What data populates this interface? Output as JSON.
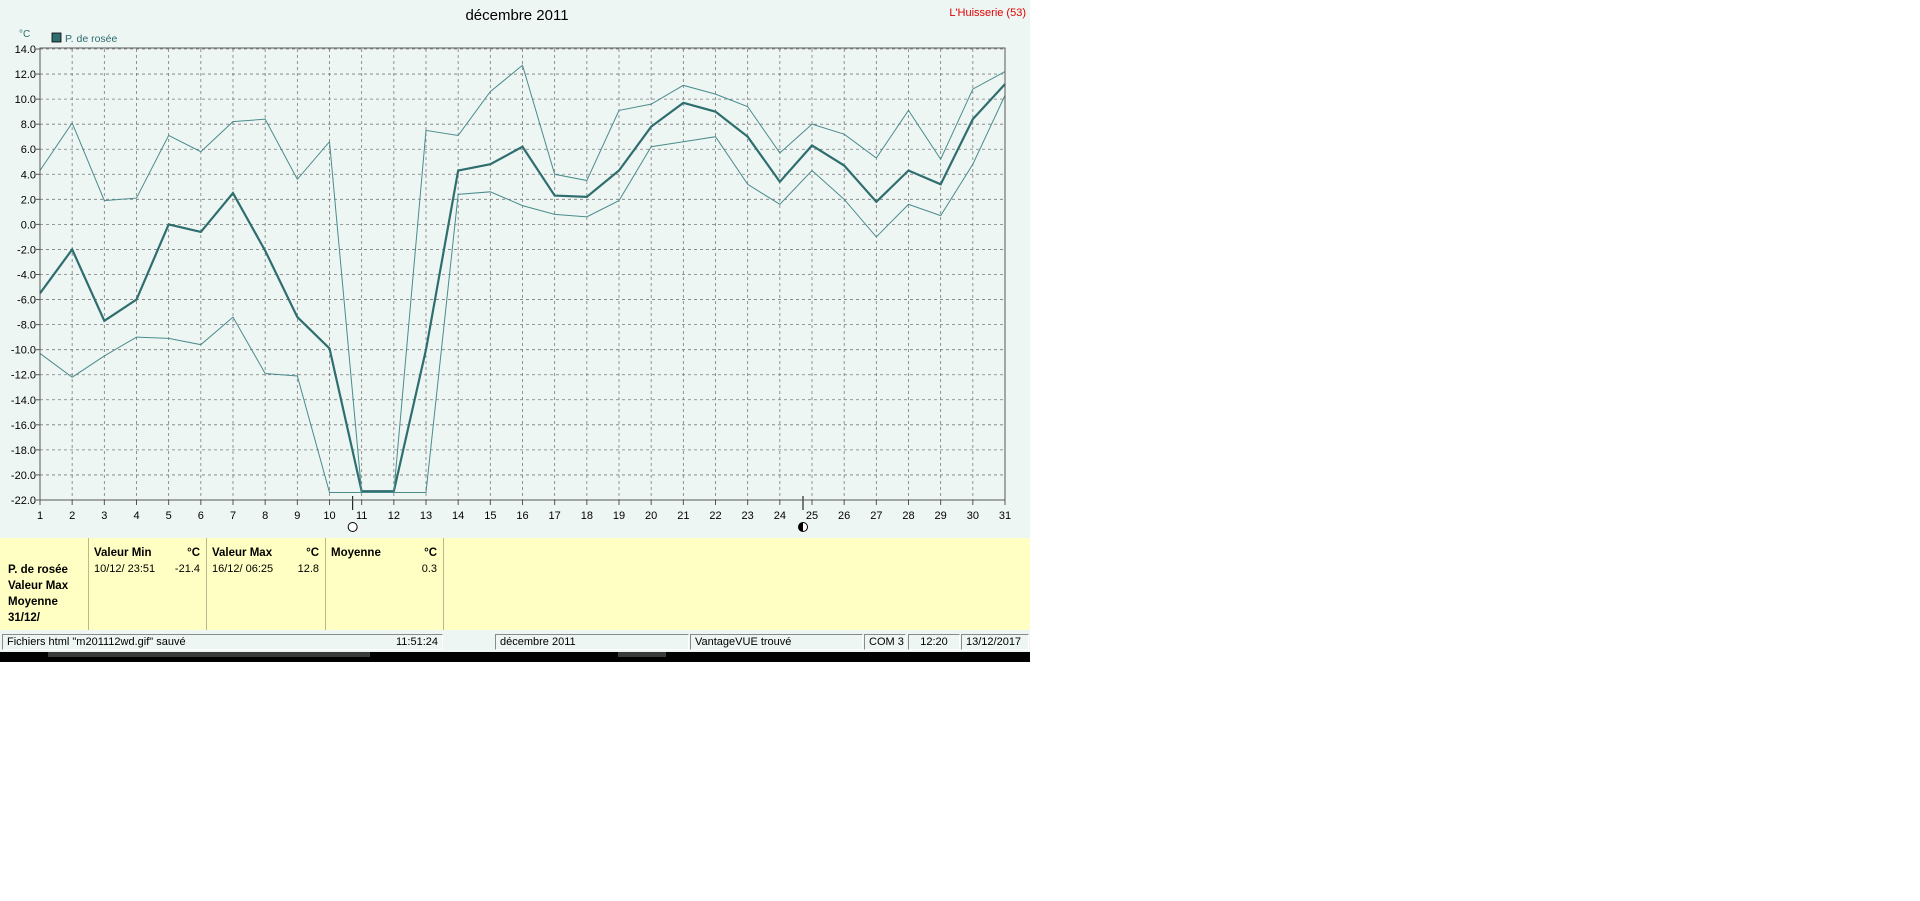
{
  "chart_data": {
    "type": "line",
    "title": "décembre 2011",
    "station": "L'Huisserie (53)",
    "ylabel": "°C",
    "legend": [
      "P. de rosée"
    ],
    "legend_position": "top-left",
    "grid": true,
    "ylim": [
      -22,
      14
    ],
    "y_ticks": [
      "14.0",
      "12.0",
      "10.0",
      "8.0",
      "6.0",
      "4.0",
      "2.0",
      "0.0",
      "-2.0",
      "-4.0",
      "-6.0",
      "-8.0",
      "-10.0",
      "-12.0",
      "-14.0",
      "-16.0",
      "-18.0",
      "-20.0",
      "-22.0"
    ],
    "x": [
      "1",
      "2",
      "3",
      "4",
      "5",
      "6",
      "7",
      "8",
      "9",
      "10",
      "11",
      "12",
      "13",
      "14",
      "15",
      "16",
      "17",
      "18",
      "19",
      "20",
      "21",
      "22",
      "23",
      "24",
      "25",
      "26",
      "27",
      "28",
      "29",
      "30",
      "31"
    ],
    "series": [
      {
        "name": "P. de rosée",
        "values": [
          -5.5,
          -2.0,
          -7.7,
          -6.0,
          0.0,
          -0.6,
          2.5,
          -2.1,
          -7.4,
          -9.9,
          -21.3,
          -21.3,
          -10.0,
          4.3,
          4.8,
          6.2,
          2.3,
          2.2,
          4.3,
          7.8,
          9.7,
          9.0,
          7.0,
          3.4,
          6.3,
          4.7,
          1.8,
          4.3,
          3.2,
          8.4,
          11.2
        ]
      },
      {
        "name": "",
        "values": [
          4.3,
          8.1,
          1.9,
          2.1,
          7.1,
          5.8,
          8.2,
          8.4,
          3.6,
          6.6,
          -21.4,
          -21.4,
          7.5,
          7.1,
          10.6,
          12.7,
          4.0,
          3.5,
          9.1,
          9.6,
          11.1,
          10.4,
          9.4,
          5.7,
          8.0,
          7.2,
          5.3,
          9.1,
          5.2,
          10.8,
          12.2
        ]
      },
      {
        "name": "",
        "values": [
          -10.3,
          -12.2,
          -10.5,
          -9.0,
          -9.1,
          -9.6,
          -7.4,
          -11.9,
          -12.1,
          -21.4,
          -21.4,
          -21.4,
          -21.4,
          2.4,
          2.6,
          1.5,
          0.8,
          0.6,
          1.9,
          6.2,
          6.6,
          7.0,
          3.2,
          1.6,
          4.3,
          2.0,
          -1.0,
          1.6,
          0.7,
          4.8,
          10.3
        ]
      }
    ],
    "moon_markers": [
      {
        "day": "11",
        "phase": "new"
      },
      {
        "day": "25",
        "phase": "first-quarter"
      }
    ]
  },
  "summary": {
    "names": [
      "P. de rosée",
      "Valeur Max",
      "Moyenne",
      "31/12/"
    ],
    "min": {
      "header": "Valeur Min",
      "unit": "°C",
      "date": "10/12/  23:51",
      "value": "-21.4"
    },
    "max": {
      "header": "Valeur Max",
      "unit": "°C",
      "date": "16/12/  06:25",
      "value": "12.8"
    },
    "avg": {
      "header": "Moyenne",
      "unit": "°C",
      "value": "0.3"
    }
  },
  "statusbar": {
    "message": "Fichiers html  \"m201112wd.gif\"  sauvé",
    "time": "11:51:24",
    "period": "décembre 2011",
    "console": "VantageVUE trouvé",
    "port": "COM 3",
    "clock": "12:20",
    "date": "13/12/2017"
  },
  "colors": {
    "background": "#eef6f4",
    "series_main": "#2f6e6e",
    "series_thin": "#4a8c8c",
    "axis_text": "#2d6b6b",
    "station_text": "#e00000",
    "panel": "#ffffc4"
  }
}
